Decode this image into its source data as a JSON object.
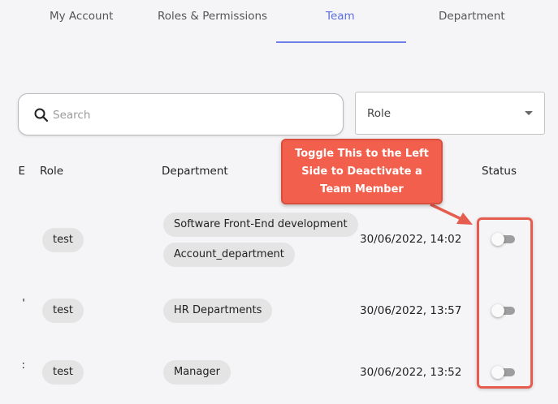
{
  "tabs": [
    {
      "label": "My Account"
    },
    {
      "label": "Roles & Permissions"
    },
    {
      "label": "Team"
    },
    {
      "label": "Department"
    }
  ],
  "active_tab": "Team",
  "search": {
    "placeholder": "Search",
    "value": "",
    "icon": "search-icon"
  },
  "role_filter": {
    "value": "Role",
    "icon": "caret-down-icon"
  },
  "table": {
    "columns": {
      "partial": "E",
      "role": "Role",
      "department": "Department",
      "status": "Status"
    },
    "rows": [
      {
        "partial": "",
        "role": "test",
        "departments": [
          "Software Front-End development",
          "Account_department"
        ],
        "date": "30/06/2022, 14:02",
        "active": false
      },
      {
        "partial": "'",
        "role": "test",
        "departments": [
          "HR Departments"
        ],
        "date": "30/06/2022, 13:57",
        "active": false
      },
      {
        "partial": ":",
        "role": "test",
        "departments": [
          "Manager"
        ],
        "date": "30/06/2022, 13:52",
        "active": false
      }
    ]
  },
  "annotation": {
    "lines": [
      "Toggle This to the Left",
      "Side to Deactivate a",
      "Team Member"
    ],
    "color": "#f25f4c",
    "border_color": "#e65c4f"
  },
  "colors": {
    "accent": "#5b6fe0",
    "chip_bg": "#e4e4e4",
    "toggle_track": "#9e9e9e"
  }
}
